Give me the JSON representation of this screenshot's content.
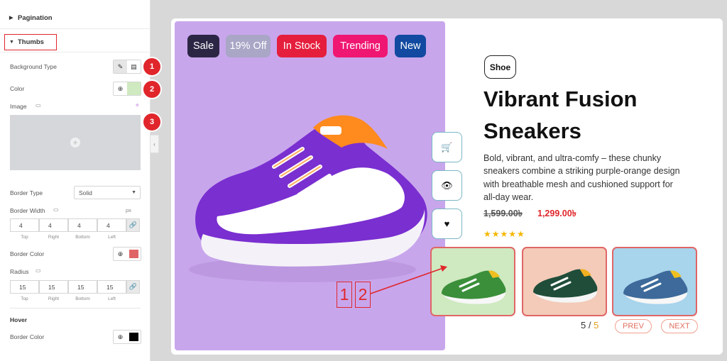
{
  "panel": {
    "pagination_label": "Pagination",
    "thumbs_label": "Thumbs",
    "background_type_label": "Background Type",
    "color_label": "Color",
    "image_label": "Image",
    "border_type_label": "Border Type",
    "border_type_value": "Solid",
    "border_width_label": "Border Width",
    "unit_label": "px",
    "border_width_values": [
      "4",
      "4",
      "4",
      "4"
    ],
    "side_labels": [
      "Top",
      "Right",
      "Bottom",
      "Left"
    ],
    "border_color_label": "Border Color",
    "radius_label": "Radius",
    "radius_values": [
      "15",
      "15",
      "15",
      "15"
    ],
    "hover_label": "Hover",
    "hover_border_color_label": "Border Color",
    "markers": [
      "1",
      "2",
      "3"
    ],
    "colors": {
      "thumb_bg": "#cfe9c0",
      "border": "#e06666",
      "hover_border": "#000000",
      "marker": "#e0262b"
    }
  },
  "product": {
    "badges": [
      "Sale",
      "19% Off",
      "In Stock",
      "Trending",
      "New"
    ],
    "category": "Shoe",
    "title_line1": "Vibrant Fusion",
    "title_line2": "Sneakers",
    "description": "Bold, vibrant, and ultra-comfy – these chunky sneakers combine a striking purple-orange design with breathable mesh and cushioned support for all-day wear.",
    "old_price": "1,599.00৳",
    "new_price": "1,299.00৳",
    "rating": "★★★★★",
    "side_actions": [
      "cart-icon",
      "eye-icon",
      "heart-icon"
    ],
    "counter_current": "5",
    "counter_sep": " / ",
    "counter_total": "5",
    "prev_label": "PREV",
    "next_label": "NEXT",
    "annotation_numbers": [
      "1",
      "2"
    ]
  }
}
